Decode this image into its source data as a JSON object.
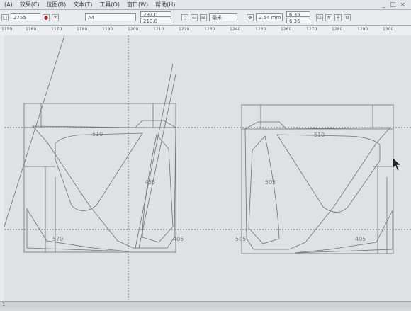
{
  "menu": {
    "items": [
      "(A)",
      "效果(C)",
      "位图(B)",
      "文本(T)",
      "工具(O)",
      "窗口(W)",
      "帮助(H)"
    ],
    "window_controls": [
      "_",
      "□",
      "×"
    ]
  },
  "toolbar": {
    "zoom_value": "2755",
    "page_size": "A4",
    "width_value": "297.0",
    "height_value": "210.0",
    "unit": "毫米",
    "nudge_value": "2.54 mm",
    "duplicate_x": "6.35",
    "duplicate_y": "6.35"
  },
  "ruler": {
    "ticks": [
      "1150",
      "1160",
      "1170",
      "1180",
      "1190",
      "1200",
      "1210",
      "1220",
      "1230",
      "1240",
      "1250",
      "1260",
      "1270",
      "1280",
      "1290",
      "1300"
    ]
  },
  "drawing": {
    "left_labels": {
      "top": "510",
      "middle": "455",
      "bottom_left": "570",
      "bottom_right": "405"
    },
    "right_labels": {
      "top": "510",
      "middle": "505",
      "bottom_left": "505",
      "bottom_right": "405"
    },
    "bottom_left_marker": "1"
  }
}
